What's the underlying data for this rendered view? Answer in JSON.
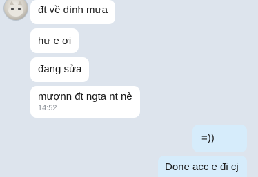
{
  "messages": [
    {
      "id": "b1",
      "direction": "incoming",
      "text": "đt về dính mưa",
      "time": ""
    },
    {
      "id": "b2",
      "direction": "incoming",
      "text": "hư e ơi",
      "time": ""
    },
    {
      "id": "b3",
      "direction": "incoming",
      "text": "đang sửa",
      "time": ""
    },
    {
      "id": "b4",
      "direction": "incoming",
      "text": "mượnn đt ngta nt nè",
      "time": "14:52"
    },
    {
      "id": "b5",
      "direction": "outgoing",
      "text": "=))",
      "time": ""
    },
    {
      "id": "b6",
      "direction": "outgoing",
      "text": "Done acc e đi cj",
      "time": ""
    }
  ],
  "colors": {
    "background": "#dde4ed",
    "incoming_bubble": "#ffffff",
    "outgoing_bubble": "#d6ecfb",
    "timestamp": "#8a8f96"
  },
  "icons": {
    "avatar": "contact-avatar-icon"
  }
}
